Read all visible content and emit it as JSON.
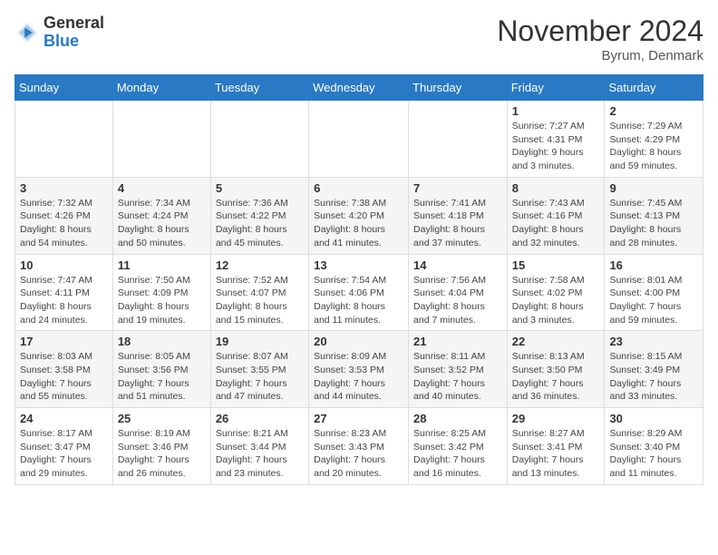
{
  "header": {
    "logo_general": "General",
    "logo_blue": "Blue",
    "month_title": "November 2024",
    "location": "Byrum, Denmark"
  },
  "days_of_week": [
    "Sunday",
    "Monday",
    "Tuesday",
    "Wednesday",
    "Thursday",
    "Friday",
    "Saturday"
  ],
  "weeks": [
    [
      {
        "day": "",
        "info": ""
      },
      {
        "day": "",
        "info": ""
      },
      {
        "day": "",
        "info": ""
      },
      {
        "day": "",
        "info": ""
      },
      {
        "day": "",
        "info": ""
      },
      {
        "day": "1",
        "info": "Sunrise: 7:27 AM\nSunset: 4:31 PM\nDaylight: 9 hours\nand 3 minutes."
      },
      {
        "day": "2",
        "info": "Sunrise: 7:29 AM\nSunset: 4:29 PM\nDaylight: 8 hours\nand 59 minutes."
      }
    ],
    [
      {
        "day": "3",
        "info": "Sunrise: 7:32 AM\nSunset: 4:26 PM\nDaylight: 8 hours\nand 54 minutes."
      },
      {
        "day": "4",
        "info": "Sunrise: 7:34 AM\nSunset: 4:24 PM\nDaylight: 8 hours\nand 50 minutes."
      },
      {
        "day": "5",
        "info": "Sunrise: 7:36 AM\nSunset: 4:22 PM\nDaylight: 8 hours\nand 45 minutes."
      },
      {
        "day": "6",
        "info": "Sunrise: 7:38 AM\nSunset: 4:20 PM\nDaylight: 8 hours\nand 41 minutes."
      },
      {
        "day": "7",
        "info": "Sunrise: 7:41 AM\nSunset: 4:18 PM\nDaylight: 8 hours\nand 37 minutes."
      },
      {
        "day": "8",
        "info": "Sunrise: 7:43 AM\nSunset: 4:16 PM\nDaylight: 8 hours\nand 32 minutes."
      },
      {
        "day": "9",
        "info": "Sunrise: 7:45 AM\nSunset: 4:13 PM\nDaylight: 8 hours\nand 28 minutes."
      }
    ],
    [
      {
        "day": "10",
        "info": "Sunrise: 7:47 AM\nSunset: 4:11 PM\nDaylight: 8 hours\nand 24 minutes."
      },
      {
        "day": "11",
        "info": "Sunrise: 7:50 AM\nSunset: 4:09 PM\nDaylight: 8 hours\nand 19 minutes."
      },
      {
        "day": "12",
        "info": "Sunrise: 7:52 AM\nSunset: 4:07 PM\nDaylight: 8 hours\nand 15 minutes."
      },
      {
        "day": "13",
        "info": "Sunrise: 7:54 AM\nSunset: 4:06 PM\nDaylight: 8 hours\nand 11 minutes."
      },
      {
        "day": "14",
        "info": "Sunrise: 7:56 AM\nSunset: 4:04 PM\nDaylight: 8 hours\nand 7 minutes."
      },
      {
        "day": "15",
        "info": "Sunrise: 7:58 AM\nSunset: 4:02 PM\nDaylight: 8 hours\nand 3 minutes."
      },
      {
        "day": "16",
        "info": "Sunrise: 8:01 AM\nSunset: 4:00 PM\nDaylight: 7 hours\nand 59 minutes."
      }
    ],
    [
      {
        "day": "17",
        "info": "Sunrise: 8:03 AM\nSunset: 3:58 PM\nDaylight: 7 hours\nand 55 minutes."
      },
      {
        "day": "18",
        "info": "Sunrise: 8:05 AM\nSunset: 3:56 PM\nDaylight: 7 hours\nand 51 minutes."
      },
      {
        "day": "19",
        "info": "Sunrise: 8:07 AM\nSunset: 3:55 PM\nDaylight: 7 hours\nand 47 minutes."
      },
      {
        "day": "20",
        "info": "Sunrise: 8:09 AM\nSunset: 3:53 PM\nDaylight: 7 hours\nand 44 minutes."
      },
      {
        "day": "21",
        "info": "Sunrise: 8:11 AM\nSunset: 3:52 PM\nDaylight: 7 hours\nand 40 minutes."
      },
      {
        "day": "22",
        "info": "Sunrise: 8:13 AM\nSunset: 3:50 PM\nDaylight: 7 hours\nand 36 minutes."
      },
      {
        "day": "23",
        "info": "Sunrise: 8:15 AM\nSunset: 3:49 PM\nDaylight: 7 hours\nand 33 minutes."
      }
    ],
    [
      {
        "day": "24",
        "info": "Sunrise: 8:17 AM\nSunset: 3:47 PM\nDaylight: 7 hours\nand 29 minutes."
      },
      {
        "day": "25",
        "info": "Sunrise: 8:19 AM\nSunset: 3:46 PM\nDaylight: 7 hours\nand 26 minutes."
      },
      {
        "day": "26",
        "info": "Sunrise: 8:21 AM\nSunset: 3:44 PM\nDaylight: 7 hours\nand 23 minutes."
      },
      {
        "day": "27",
        "info": "Sunrise: 8:23 AM\nSunset: 3:43 PM\nDaylight: 7 hours\nand 20 minutes."
      },
      {
        "day": "28",
        "info": "Sunrise: 8:25 AM\nSunset: 3:42 PM\nDaylight: 7 hours\nand 16 minutes."
      },
      {
        "day": "29",
        "info": "Sunrise: 8:27 AM\nSunset: 3:41 PM\nDaylight: 7 hours\nand 13 minutes."
      },
      {
        "day": "30",
        "info": "Sunrise: 8:29 AM\nSunset: 3:40 PM\nDaylight: 7 hours\nand 11 minutes."
      }
    ]
  ]
}
